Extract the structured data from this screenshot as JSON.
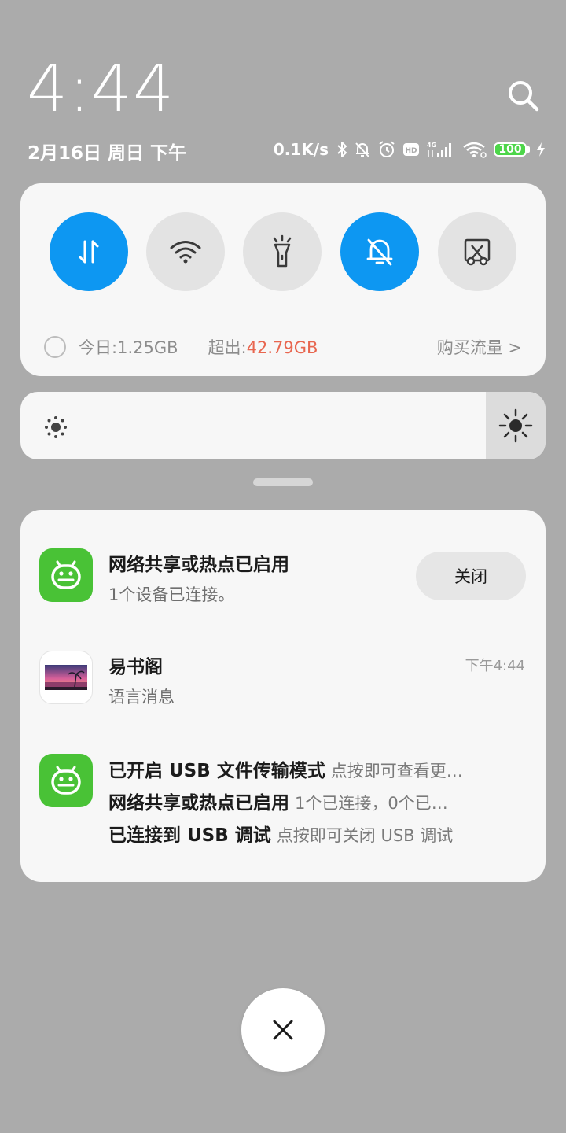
{
  "header": {
    "time": "4:44",
    "date": "2月16日 周日 下午"
  },
  "status_bar": {
    "net_speed": "0.1K/s",
    "battery": "100",
    "network_label": "4G",
    "hd_label": "HD",
    "icons": [
      "bluetooth-icon",
      "mute-bell-icon",
      "alarm-icon",
      "hd-icon",
      "signal-icon",
      "wifi-hotspot-icon",
      "battery-icon",
      "charging-icon"
    ]
  },
  "quick_settings": {
    "toggles": [
      {
        "name": "mobile-data",
        "icon": "mobile-data-icon",
        "on": true
      },
      {
        "name": "wifi",
        "icon": "wifi-icon",
        "on": false
      },
      {
        "name": "flashlight",
        "icon": "flashlight-icon",
        "on": false
      },
      {
        "name": "silent",
        "icon": "mute-bell-icon",
        "on": true
      },
      {
        "name": "screenshot",
        "icon": "screenshot-icon",
        "on": false
      }
    ],
    "data_usage": {
      "today_label": "今日:",
      "today_value": "1.25GB",
      "over_label": "超出:",
      "over_value": "42.79GB",
      "buy_label": "购买流量 >"
    },
    "colors": {
      "on": "#0d97f2",
      "off": "#e3e3e3",
      "over": "#e8664f"
    }
  },
  "brightness": {
    "icons": [
      "brightness-low-icon",
      "brightness-high-icon"
    ]
  },
  "notifications": [
    {
      "title": "网络共享或热点已启用",
      "subtitle": "1个设备已连接。",
      "action": "关闭",
      "icon": "android-icon"
    },
    {
      "title": "易书阁",
      "subtitle": "语言消息",
      "time": "下午4:44",
      "icon": "app-thumbnail"
    },
    {
      "icon": "android-icon",
      "lines": [
        {
          "title": "已开启 USB 文件传输模式",
          "text": "点按即可查看更…"
        },
        {
          "title": "网络共享或热点已启用",
          "text": "1个已连接，0个已…"
        },
        {
          "title": "已连接到 USB 调试",
          "text": "点按即可关闭 USB 调试"
        }
      ]
    }
  ],
  "colors": {
    "app_green": "#49c236",
    "background": "#ababab",
    "panel": "#f7f7f7"
  }
}
